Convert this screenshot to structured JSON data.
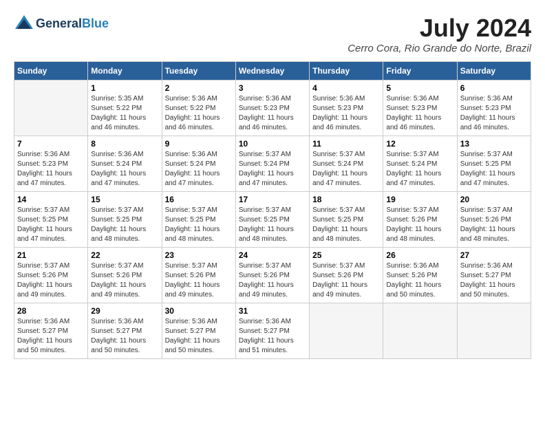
{
  "header": {
    "logo_line1": "General",
    "logo_line2": "Blue",
    "month": "July 2024",
    "location": "Cerro Cora, Rio Grande do Norte, Brazil"
  },
  "weekdays": [
    "Sunday",
    "Monday",
    "Tuesday",
    "Wednesday",
    "Thursday",
    "Friday",
    "Saturday"
  ],
  "weeks": [
    [
      {
        "day": "",
        "empty": true
      },
      {
        "day": "1",
        "sunrise": "5:35 AM",
        "sunset": "5:22 PM",
        "daylight": "11 hours and 46 minutes."
      },
      {
        "day": "2",
        "sunrise": "5:36 AM",
        "sunset": "5:22 PM",
        "daylight": "11 hours and 46 minutes."
      },
      {
        "day": "3",
        "sunrise": "5:36 AM",
        "sunset": "5:23 PM",
        "daylight": "11 hours and 46 minutes."
      },
      {
        "day": "4",
        "sunrise": "5:36 AM",
        "sunset": "5:23 PM",
        "daylight": "11 hours and 46 minutes."
      },
      {
        "day": "5",
        "sunrise": "5:36 AM",
        "sunset": "5:23 PM",
        "daylight": "11 hours and 46 minutes."
      },
      {
        "day": "6",
        "sunrise": "5:36 AM",
        "sunset": "5:23 PM",
        "daylight": "11 hours and 46 minutes."
      }
    ],
    [
      {
        "day": "7",
        "sunrise": "5:36 AM",
        "sunset": "5:23 PM",
        "daylight": "11 hours and 47 minutes."
      },
      {
        "day": "8",
        "sunrise": "5:36 AM",
        "sunset": "5:24 PM",
        "daylight": "11 hours and 47 minutes."
      },
      {
        "day": "9",
        "sunrise": "5:36 AM",
        "sunset": "5:24 PM",
        "daylight": "11 hours and 47 minutes."
      },
      {
        "day": "10",
        "sunrise": "5:37 AM",
        "sunset": "5:24 PM",
        "daylight": "11 hours and 47 minutes."
      },
      {
        "day": "11",
        "sunrise": "5:37 AM",
        "sunset": "5:24 PM",
        "daylight": "11 hours and 47 minutes."
      },
      {
        "day": "12",
        "sunrise": "5:37 AM",
        "sunset": "5:24 PM",
        "daylight": "11 hours and 47 minutes."
      },
      {
        "day": "13",
        "sunrise": "5:37 AM",
        "sunset": "5:25 PM",
        "daylight": "11 hours and 47 minutes."
      }
    ],
    [
      {
        "day": "14",
        "sunrise": "5:37 AM",
        "sunset": "5:25 PM",
        "daylight": "11 hours and 47 minutes."
      },
      {
        "day": "15",
        "sunrise": "5:37 AM",
        "sunset": "5:25 PM",
        "daylight": "11 hours and 48 minutes."
      },
      {
        "day": "16",
        "sunrise": "5:37 AM",
        "sunset": "5:25 PM",
        "daylight": "11 hours and 48 minutes."
      },
      {
        "day": "17",
        "sunrise": "5:37 AM",
        "sunset": "5:25 PM",
        "daylight": "11 hours and 48 minutes."
      },
      {
        "day": "18",
        "sunrise": "5:37 AM",
        "sunset": "5:25 PM",
        "daylight": "11 hours and 48 minutes."
      },
      {
        "day": "19",
        "sunrise": "5:37 AM",
        "sunset": "5:26 PM",
        "daylight": "11 hours and 48 minutes."
      },
      {
        "day": "20",
        "sunrise": "5:37 AM",
        "sunset": "5:26 PM",
        "daylight": "11 hours and 48 minutes."
      }
    ],
    [
      {
        "day": "21",
        "sunrise": "5:37 AM",
        "sunset": "5:26 PM",
        "daylight": "11 hours and 49 minutes."
      },
      {
        "day": "22",
        "sunrise": "5:37 AM",
        "sunset": "5:26 PM",
        "daylight": "11 hours and 49 minutes."
      },
      {
        "day": "23",
        "sunrise": "5:37 AM",
        "sunset": "5:26 PM",
        "daylight": "11 hours and 49 minutes."
      },
      {
        "day": "24",
        "sunrise": "5:37 AM",
        "sunset": "5:26 PM",
        "daylight": "11 hours and 49 minutes."
      },
      {
        "day": "25",
        "sunrise": "5:37 AM",
        "sunset": "5:26 PM",
        "daylight": "11 hours and 49 minutes."
      },
      {
        "day": "26",
        "sunrise": "5:36 AM",
        "sunset": "5:26 PM",
        "daylight": "11 hours and 50 minutes."
      },
      {
        "day": "27",
        "sunrise": "5:36 AM",
        "sunset": "5:27 PM",
        "daylight": "11 hours and 50 minutes."
      }
    ],
    [
      {
        "day": "28",
        "sunrise": "5:36 AM",
        "sunset": "5:27 PM",
        "daylight": "11 hours and 50 minutes."
      },
      {
        "day": "29",
        "sunrise": "5:36 AM",
        "sunset": "5:27 PM",
        "daylight": "11 hours and 50 minutes."
      },
      {
        "day": "30",
        "sunrise": "5:36 AM",
        "sunset": "5:27 PM",
        "daylight": "11 hours and 50 minutes."
      },
      {
        "day": "31",
        "sunrise": "5:36 AM",
        "sunset": "5:27 PM",
        "daylight": "11 hours and 51 minutes."
      },
      {
        "day": "",
        "empty": true
      },
      {
        "day": "",
        "empty": true
      },
      {
        "day": "",
        "empty": true
      }
    ]
  ]
}
